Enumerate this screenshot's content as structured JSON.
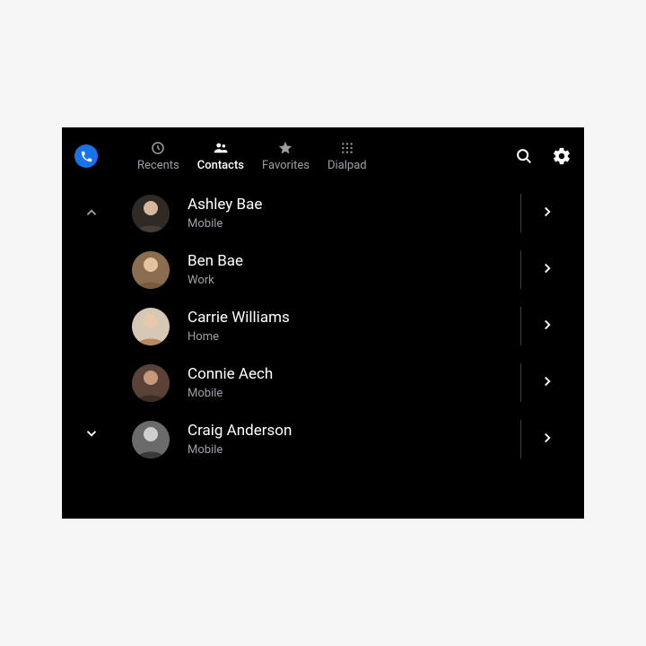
{
  "tabs": [
    {
      "label": "Recents"
    },
    {
      "label": "Contacts"
    },
    {
      "label": "Favorites"
    },
    {
      "label": "Dialpad"
    }
  ],
  "contacts": [
    {
      "name": "Ashley Bae",
      "type": "Mobile"
    },
    {
      "name": "Ben Bae",
      "type": "Work"
    },
    {
      "name": "Carrie Williams",
      "type": "Home"
    },
    {
      "name": "Connie Aech",
      "type": "Mobile"
    },
    {
      "name": "Craig Anderson",
      "type": "Mobile"
    }
  ]
}
